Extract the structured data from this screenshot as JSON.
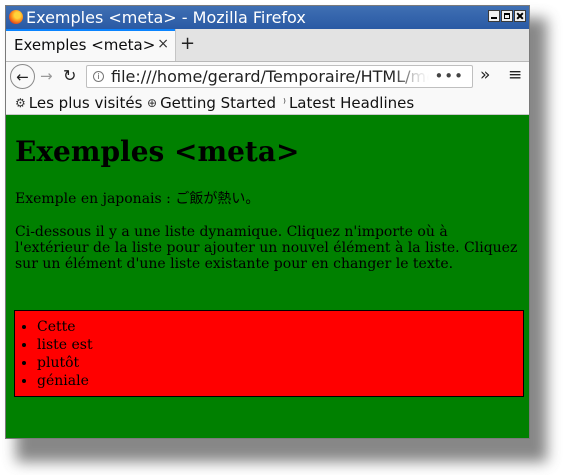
{
  "window": {
    "title": "Exemples <meta> - Mozilla Firefox"
  },
  "tabs": [
    {
      "label": "Exemples <meta>",
      "close": "×",
      "active": true
    }
  ],
  "new_tab": "+",
  "nav": {
    "back": "←",
    "forward": "→",
    "reload": "↻",
    "url_main": "file:///home/gerard/Temporaire/HTML/",
    "url_fade": "meta",
    "page_actions": "•••",
    "overflow": "»",
    "menu": "≡"
  },
  "bookmarks": [
    {
      "icon": "gear-icon",
      "glyph": "⚙",
      "label": "Les plus visités"
    },
    {
      "icon": "globe-icon",
      "glyph": "⊕",
      "label": "Getting Started"
    },
    {
      "icon": "rss-icon",
      "glyph": "⁾",
      "label": "Latest Headlines"
    }
  ],
  "page": {
    "heading": "Exemples <meta>",
    "japanese_example": "Exemple en japonais : ご飯が熱い。",
    "instructions": "Ci-dessous il y a une liste dynamique. Cliquez n'importe où à l'extérieur de la liste pour ajouter un nouvel élément à la liste. Cliquez sur un élément d'une liste existante pour en changer le texte.",
    "list_items": [
      "Cette",
      "liste est",
      "plutôt",
      "géniale"
    ]
  },
  "colors": {
    "page_background": "#008000",
    "list_background": "#ff0000",
    "titlebar": "#2f5fa8",
    "active_tab_accent": "#0a84ff"
  }
}
